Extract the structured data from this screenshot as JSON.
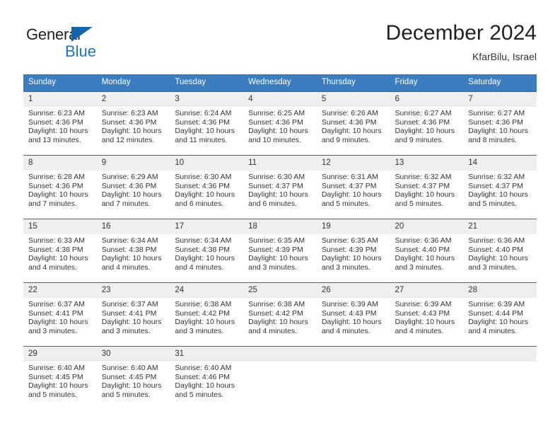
{
  "logo": {
    "primary_text": "General",
    "secondary_text": "Blue",
    "primary_color": "#222222",
    "secondary_color": "#1b76c4",
    "triangle_color": "#1565ad",
    "icon": "triangle-icon"
  },
  "header": {
    "title": "December 2024",
    "subtitle": "KfarBilu, Israel"
  },
  "theme": {
    "header_bg": "#3b7dbf",
    "header_text": "#ffffff",
    "row_divider": "#2d6ca8",
    "daynum_bg": "#efefef",
    "body_text": "#333333"
  },
  "weekday_headers": [
    "Sunday",
    "Monday",
    "Tuesday",
    "Wednesday",
    "Thursday",
    "Friday",
    "Saturday"
  ],
  "weeks": [
    {
      "days": [
        {
          "day": "1",
          "sunrise": "Sunrise: 6:23 AM",
          "sunset": "Sunset: 4:36 PM",
          "daylight": "Daylight: 10 hours and 13 minutes."
        },
        {
          "day": "2",
          "sunrise": "Sunrise: 6:23 AM",
          "sunset": "Sunset: 4:36 PM",
          "daylight": "Daylight: 10 hours and 12 minutes."
        },
        {
          "day": "3",
          "sunrise": "Sunrise: 6:24 AM",
          "sunset": "Sunset: 4:36 PM",
          "daylight": "Daylight: 10 hours and 11 minutes."
        },
        {
          "day": "4",
          "sunrise": "Sunrise: 6:25 AM",
          "sunset": "Sunset: 4:36 PM",
          "daylight": "Daylight: 10 hours and 10 minutes."
        },
        {
          "day": "5",
          "sunrise": "Sunrise: 6:26 AM",
          "sunset": "Sunset: 4:36 PM",
          "daylight": "Daylight: 10 hours and 9 minutes."
        },
        {
          "day": "6",
          "sunrise": "Sunrise: 6:27 AM",
          "sunset": "Sunset: 4:36 PM",
          "daylight": "Daylight: 10 hours and 9 minutes."
        },
        {
          "day": "7",
          "sunrise": "Sunrise: 6:27 AM",
          "sunset": "Sunset: 4:36 PM",
          "daylight": "Daylight: 10 hours and 8 minutes."
        }
      ]
    },
    {
      "days": [
        {
          "day": "8",
          "sunrise": "Sunrise: 6:28 AM",
          "sunset": "Sunset: 4:36 PM",
          "daylight": "Daylight: 10 hours and 7 minutes."
        },
        {
          "day": "9",
          "sunrise": "Sunrise: 6:29 AM",
          "sunset": "Sunset: 4:36 PM",
          "daylight": "Daylight: 10 hours and 7 minutes."
        },
        {
          "day": "10",
          "sunrise": "Sunrise: 6:30 AM",
          "sunset": "Sunset: 4:36 PM",
          "daylight": "Daylight: 10 hours and 6 minutes."
        },
        {
          "day": "11",
          "sunrise": "Sunrise: 6:30 AM",
          "sunset": "Sunset: 4:37 PM",
          "daylight": "Daylight: 10 hours and 6 minutes."
        },
        {
          "day": "12",
          "sunrise": "Sunrise: 6:31 AM",
          "sunset": "Sunset: 4:37 PM",
          "daylight": "Daylight: 10 hours and 5 minutes."
        },
        {
          "day": "13",
          "sunrise": "Sunrise: 6:32 AM",
          "sunset": "Sunset: 4:37 PM",
          "daylight": "Daylight: 10 hours and 5 minutes."
        },
        {
          "day": "14",
          "sunrise": "Sunrise: 6:32 AM",
          "sunset": "Sunset: 4:37 PM",
          "daylight": "Daylight: 10 hours and 5 minutes."
        }
      ]
    },
    {
      "days": [
        {
          "day": "15",
          "sunrise": "Sunrise: 6:33 AM",
          "sunset": "Sunset: 4:38 PM",
          "daylight": "Daylight: 10 hours and 4 minutes."
        },
        {
          "day": "16",
          "sunrise": "Sunrise: 6:34 AM",
          "sunset": "Sunset: 4:38 PM",
          "daylight": "Daylight: 10 hours and 4 minutes."
        },
        {
          "day": "17",
          "sunrise": "Sunrise: 6:34 AM",
          "sunset": "Sunset: 4:38 PM",
          "daylight": "Daylight: 10 hours and 4 minutes."
        },
        {
          "day": "18",
          "sunrise": "Sunrise: 6:35 AM",
          "sunset": "Sunset: 4:39 PM",
          "daylight": "Daylight: 10 hours and 3 minutes."
        },
        {
          "day": "19",
          "sunrise": "Sunrise: 6:35 AM",
          "sunset": "Sunset: 4:39 PM",
          "daylight": "Daylight: 10 hours and 3 minutes."
        },
        {
          "day": "20",
          "sunrise": "Sunrise: 6:36 AM",
          "sunset": "Sunset: 4:40 PM",
          "daylight": "Daylight: 10 hours and 3 minutes."
        },
        {
          "day": "21",
          "sunrise": "Sunrise: 6:36 AM",
          "sunset": "Sunset: 4:40 PM",
          "daylight": "Daylight: 10 hours and 3 minutes."
        }
      ]
    },
    {
      "days": [
        {
          "day": "22",
          "sunrise": "Sunrise: 6:37 AM",
          "sunset": "Sunset: 4:41 PM",
          "daylight": "Daylight: 10 hours and 3 minutes."
        },
        {
          "day": "23",
          "sunrise": "Sunrise: 6:37 AM",
          "sunset": "Sunset: 4:41 PM",
          "daylight": "Daylight: 10 hours and 3 minutes."
        },
        {
          "day": "24",
          "sunrise": "Sunrise: 6:38 AM",
          "sunset": "Sunset: 4:42 PM",
          "daylight": "Daylight: 10 hours and 3 minutes."
        },
        {
          "day": "25",
          "sunrise": "Sunrise: 6:38 AM",
          "sunset": "Sunset: 4:42 PM",
          "daylight": "Daylight: 10 hours and 4 minutes."
        },
        {
          "day": "26",
          "sunrise": "Sunrise: 6:39 AM",
          "sunset": "Sunset: 4:43 PM",
          "daylight": "Daylight: 10 hours and 4 minutes."
        },
        {
          "day": "27",
          "sunrise": "Sunrise: 6:39 AM",
          "sunset": "Sunset: 4:43 PM",
          "daylight": "Daylight: 10 hours and 4 minutes."
        },
        {
          "day": "28",
          "sunrise": "Sunrise: 6:39 AM",
          "sunset": "Sunset: 4:44 PM",
          "daylight": "Daylight: 10 hours and 4 minutes."
        }
      ]
    },
    {
      "days": [
        {
          "day": "29",
          "sunrise": "Sunrise: 6:40 AM",
          "sunset": "Sunset: 4:45 PM",
          "daylight": "Daylight: 10 hours and 5 minutes."
        },
        {
          "day": "30",
          "sunrise": "Sunrise: 6:40 AM",
          "sunset": "Sunset: 4:45 PM",
          "daylight": "Daylight: 10 hours and 5 minutes."
        },
        {
          "day": "31",
          "sunrise": "Sunrise: 6:40 AM",
          "sunset": "Sunset: 4:46 PM",
          "daylight": "Daylight: 10 hours and 5 minutes."
        },
        {
          "day": "",
          "sunrise": "",
          "sunset": "",
          "daylight": ""
        },
        {
          "day": "",
          "sunrise": "",
          "sunset": "",
          "daylight": ""
        },
        {
          "day": "",
          "sunrise": "",
          "sunset": "",
          "daylight": ""
        },
        {
          "day": "",
          "sunrise": "",
          "sunset": "",
          "daylight": ""
        }
      ]
    }
  ]
}
